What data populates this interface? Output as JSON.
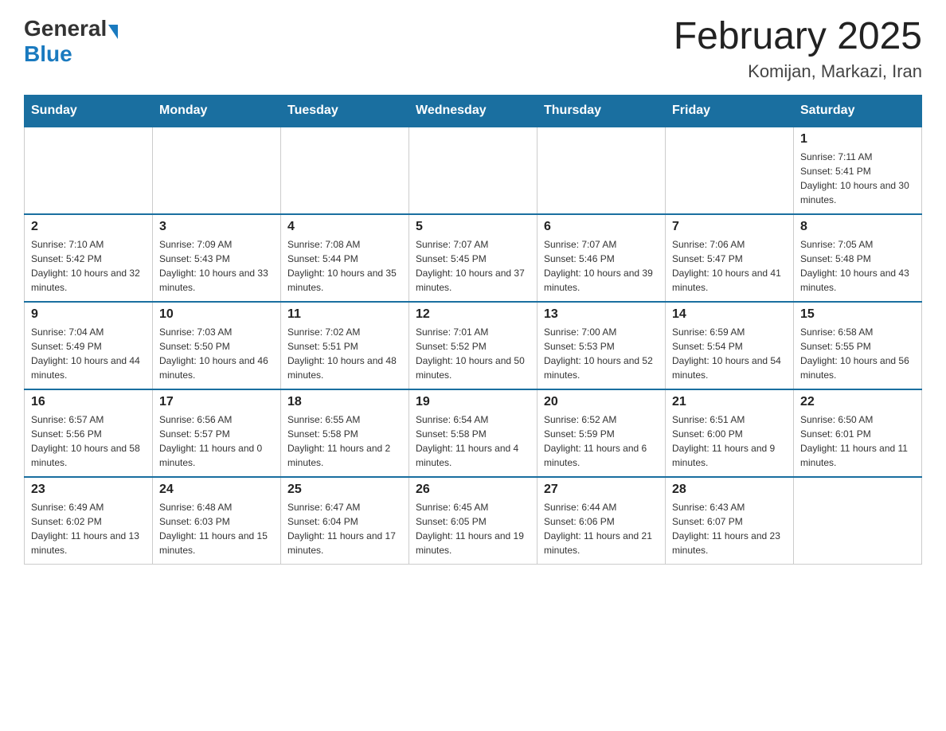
{
  "header": {
    "logo_general": "General",
    "logo_blue": "Blue",
    "month_title": "February 2025",
    "location": "Komijan, Markazi, Iran"
  },
  "days_of_week": [
    "Sunday",
    "Monday",
    "Tuesday",
    "Wednesday",
    "Thursday",
    "Friday",
    "Saturday"
  ],
  "weeks": [
    [
      {
        "day": "",
        "sunrise": "",
        "sunset": "",
        "daylight": "",
        "empty": true
      },
      {
        "day": "",
        "sunrise": "",
        "sunset": "",
        "daylight": "",
        "empty": true
      },
      {
        "day": "",
        "sunrise": "",
        "sunset": "",
        "daylight": "",
        "empty": true
      },
      {
        "day": "",
        "sunrise": "",
        "sunset": "",
        "daylight": "",
        "empty": true
      },
      {
        "day": "",
        "sunrise": "",
        "sunset": "",
        "daylight": "",
        "empty": true
      },
      {
        "day": "",
        "sunrise": "",
        "sunset": "",
        "daylight": "",
        "empty": true
      },
      {
        "day": "1",
        "sunrise": "Sunrise: 7:11 AM",
        "sunset": "Sunset: 5:41 PM",
        "daylight": "Daylight: 10 hours and 30 minutes.",
        "empty": false
      }
    ],
    [
      {
        "day": "2",
        "sunrise": "Sunrise: 7:10 AM",
        "sunset": "Sunset: 5:42 PM",
        "daylight": "Daylight: 10 hours and 32 minutes.",
        "empty": false
      },
      {
        "day": "3",
        "sunrise": "Sunrise: 7:09 AM",
        "sunset": "Sunset: 5:43 PM",
        "daylight": "Daylight: 10 hours and 33 minutes.",
        "empty": false
      },
      {
        "day": "4",
        "sunrise": "Sunrise: 7:08 AM",
        "sunset": "Sunset: 5:44 PM",
        "daylight": "Daylight: 10 hours and 35 minutes.",
        "empty": false
      },
      {
        "day": "5",
        "sunrise": "Sunrise: 7:07 AM",
        "sunset": "Sunset: 5:45 PM",
        "daylight": "Daylight: 10 hours and 37 minutes.",
        "empty": false
      },
      {
        "day": "6",
        "sunrise": "Sunrise: 7:07 AM",
        "sunset": "Sunset: 5:46 PM",
        "daylight": "Daylight: 10 hours and 39 minutes.",
        "empty": false
      },
      {
        "day": "7",
        "sunrise": "Sunrise: 7:06 AM",
        "sunset": "Sunset: 5:47 PM",
        "daylight": "Daylight: 10 hours and 41 minutes.",
        "empty": false
      },
      {
        "day": "8",
        "sunrise": "Sunrise: 7:05 AM",
        "sunset": "Sunset: 5:48 PM",
        "daylight": "Daylight: 10 hours and 43 minutes.",
        "empty": false
      }
    ],
    [
      {
        "day": "9",
        "sunrise": "Sunrise: 7:04 AM",
        "sunset": "Sunset: 5:49 PM",
        "daylight": "Daylight: 10 hours and 44 minutes.",
        "empty": false
      },
      {
        "day": "10",
        "sunrise": "Sunrise: 7:03 AM",
        "sunset": "Sunset: 5:50 PM",
        "daylight": "Daylight: 10 hours and 46 minutes.",
        "empty": false
      },
      {
        "day": "11",
        "sunrise": "Sunrise: 7:02 AM",
        "sunset": "Sunset: 5:51 PM",
        "daylight": "Daylight: 10 hours and 48 minutes.",
        "empty": false
      },
      {
        "day": "12",
        "sunrise": "Sunrise: 7:01 AM",
        "sunset": "Sunset: 5:52 PM",
        "daylight": "Daylight: 10 hours and 50 minutes.",
        "empty": false
      },
      {
        "day": "13",
        "sunrise": "Sunrise: 7:00 AM",
        "sunset": "Sunset: 5:53 PM",
        "daylight": "Daylight: 10 hours and 52 minutes.",
        "empty": false
      },
      {
        "day": "14",
        "sunrise": "Sunrise: 6:59 AM",
        "sunset": "Sunset: 5:54 PM",
        "daylight": "Daylight: 10 hours and 54 minutes.",
        "empty": false
      },
      {
        "day": "15",
        "sunrise": "Sunrise: 6:58 AM",
        "sunset": "Sunset: 5:55 PM",
        "daylight": "Daylight: 10 hours and 56 minutes.",
        "empty": false
      }
    ],
    [
      {
        "day": "16",
        "sunrise": "Sunrise: 6:57 AM",
        "sunset": "Sunset: 5:56 PM",
        "daylight": "Daylight: 10 hours and 58 minutes.",
        "empty": false
      },
      {
        "day": "17",
        "sunrise": "Sunrise: 6:56 AM",
        "sunset": "Sunset: 5:57 PM",
        "daylight": "Daylight: 11 hours and 0 minutes.",
        "empty": false
      },
      {
        "day": "18",
        "sunrise": "Sunrise: 6:55 AM",
        "sunset": "Sunset: 5:58 PM",
        "daylight": "Daylight: 11 hours and 2 minutes.",
        "empty": false
      },
      {
        "day": "19",
        "sunrise": "Sunrise: 6:54 AM",
        "sunset": "Sunset: 5:58 PM",
        "daylight": "Daylight: 11 hours and 4 minutes.",
        "empty": false
      },
      {
        "day": "20",
        "sunrise": "Sunrise: 6:52 AM",
        "sunset": "Sunset: 5:59 PM",
        "daylight": "Daylight: 11 hours and 6 minutes.",
        "empty": false
      },
      {
        "day": "21",
        "sunrise": "Sunrise: 6:51 AM",
        "sunset": "Sunset: 6:00 PM",
        "daylight": "Daylight: 11 hours and 9 minutes.",
        "empty": false
      },
      {
        "day": "22",
        "sunrise": "Sunrise: 6:50 AM",
        "sunset": "Sunset: 6:01 PM",
        "daylight": "Daylight: 11 hours and 11 minutes.",
        "empty": false
      }
    ],
    [
      {
        "day": "23",
        "sunrise": "Sunrise: 6:49 AM",
        "sunset": "Sunset: 6:02 PM",
        "daylight": "Daylight: 11 hours and 13 minutes.",
        "empty": false
      },
      {
        "day": "24",
        "sunrise": "Sunrise: 6:48 AM",
        "sunset": "Sunset: 6:03 PM",
        "daylight": "Daylight: 11 hours and 15 minutes.",
        "empty": false
      },
      {
        "day": "25",
        "sunrise": "Sunrise: 6:47 AM",
        "sunset": "Sunset: 6:04 PM",
        "daylight": "Daylight: 11 hours and 17 minutes.",
        "empty": false
      },
      {
        "day": "26",
        "sunrise": "Sunrise: 6:45 AM",
        "sunset": "Sunset: 6:05 PM",
        "daylight": "Daylight: 11 hours and 19 minutes.",
        "empty": false
      },
      {
        "day": "27",
        "sunrise": "Sunrise: 6:44 AM",
        "sunset": "Sunset: 6:06 PM",
        "daylight": "Daylight: 11 hours and 21 minutes.",
        "empty": false
      },
      {
        "day": "28",
        "sunrise": "Sunrise: 6:43 AM",
        "sunset": "Sunset: 6:07 PM",
        "daylight": "Daylight: 11 hours and 23 minutes.",
        "empty": false
      },
      {
        "day": "",
        "sunrise": "",
        "sunset": "",
        "daylight": "",
        "empty": true
      }
    ]
  ]
}
